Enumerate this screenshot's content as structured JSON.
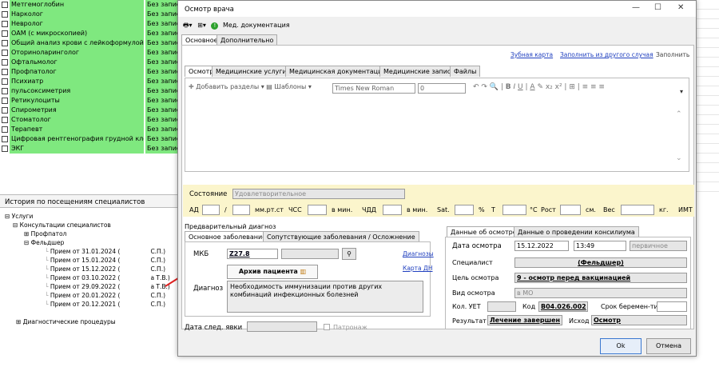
{
  "services": [
    {
      "name": "Метгемоглобин",
      "status": "Без запис"
    },
    {
      "name": "Нарколог",
      "status": "Без запис"
    },
    {
      "name": "Невролог",
      "status": "Без запис"
    },
    {
      "name": "ОАМ (с микроскопией)",
      "status": "Без запис"
    },
    {
      "name": "Общий анализ крови с лейкоформулой",
      "status": "Без запис"
    },
    {
      "name": "Оториноларинголог",
      "status": "Без запис"
    },
    {
      "name": "Офтальмолог",
      "status": "Без запис"
    },
    {
      "name": "Профпатолог",
      "status": "Без запис"
    },
    {
      "name": "Психиатр",
      "status": "Без запис"
    },
    {
      "name": "пульсоксиметрия",
      "status": "Без запис"
    },
    {
      "name": "Ретикулоциты",
      "status": "Без запис"
    },
    {
      "name": "Спирометрия",
      "status": "Без запис"
    },
    {
      "name": "Стоматолог",
      "status": "Без запис"
    },
    {
      "name": "Терапевт",
      "status": "Без запис"
    },
    {
      "name": "Цифровая рентгенография грудной кле...",
      "status": "Без запис"
    },
    {
      "name": "ЭКГ",
      "status": "Без запис"
    }
  ],
  "history": {
    "title": "История по посещениям специалистов",
    "root": "Услуги",
    "consult": "Консультации специалистов",
    "profpat": "Профпатол",
    "feldsher": "Фельдшер",
    "visits": [
      {
        "date": "Прием от 31.01.2024 (",
        "who": "С.П.)"
      },
      {
        "date": "Прием от 15.01.2024 (",
        "who": "С.П.)"
      },
      {
        "date": "Прием от 15.12.2022 (",
        "who": "С.П.)"
      },
      {
        "date": "Прием от 03.10.2022 (",
        "who": "а Т.В.)"
      },
      {
        "date": "Прием от 29.09.2022 (",
        "who": "а Т.В.)"
      },
      {
        "date": "Прием от 20.01.2022 (",
        "who": "С.П.)"
      },
      {
        "date": "Прием от 20.12.2021 (",
        "who": "С.П.)"
      }
    ],
    "diag": "Диагностические процедуры"
  },
  "dialog": {
    "title": "Осмотр врача",
    "win_min": "—",
    "win_max": "☐",
    "win_close": "✕",
    "med_doc": "Мед. документация",
    "tabs": [
      "Основное",
      "Дополнительно"
    ],
    "links": {
      "dental": "Зубная карта",
      "fill_other": "Заполнить из другого случая",
      "fill": "Заполнить"
    },
    "subtabs": [
      "Осмотр",
      "Медицинские услуги",
      "Медицинская документация",
      "Медицинские записи",
      "Файлы"
    ],
    "editor": {
      "add_sections": "Добавить разделы",
      "templates": "Шаблоны",
      "font": "Times New Roman",
      "size": "0"
    },
    "state": {
      "label": "Состояние",
      "value": "Удовлетворительное"
    },
    "vitals": {
      "ad": "АД",
      "slash": "/",
      "mmhg": "мм.рт.ст",
      "chss": "ЧСС",
      "permin1": "в мин.",
      "chdd": "ЧДД",
      "permin2": "в мин.",
      "sat": "Sat.",
      "pct": "%",
      "t": "Т",
      "c": "°С",
      "height": "Рост",
      "cm": "см.",
      "weight": "Вес",
      "kg": "кг.",
      "imt": "ИМТ"
    },
    "prelim": {
      "title": "Предварительный диагноз",
      "tabs": [
        "Основное заболевание",
        "Сопутствующие заболевания / Осложнение"
      ],
      "mkb_label": "МКБ",
      "mkb": "Z27.8",
      "diagnoses_link": "Диагнозы",
      "dn_link": "Карта ДН",
      "archive": "Архив пациента",
      "diag_label": "Диагноз",
      "diag_text": "Необходимость иммунизации против других комбинаций инфекционных болезней"
    },
    "next_visit": {
      "label": "Дата след. явки",
      "patronage": "Патронаж"
    },
    "exam": {
      "tabs": [
        "Данные об осмотре",
        "Данные о проведении консилиума"
      ],
      "date_label": "Дата осмотра",
      "date": "15.12.2022",
      "time": "13:49",
      "primary": "первичное",
      "spec_label": "Специалист",
      "spec": "(Фельдшер)",
      "goal_label": "Цель осмотра",
      "goal": "9 - осмотр перед вакцинацией",
      "kind_label": "Вид осмотра",
      "kind": "в МО",
      "uet_label": "Кол. УЕТ",
      "code_label": "Код",
      "code": "B04.026.002",
      "preg_label": "Срок беремен-ти",
      "result_label": "Результат",
      "result": "Лечение завершен",
      "outcome_label": "Исход",
      "outcome": "Осмотр"
    },
    "ok": "Ok",
    "cancel": "Отмена"
  }
}
